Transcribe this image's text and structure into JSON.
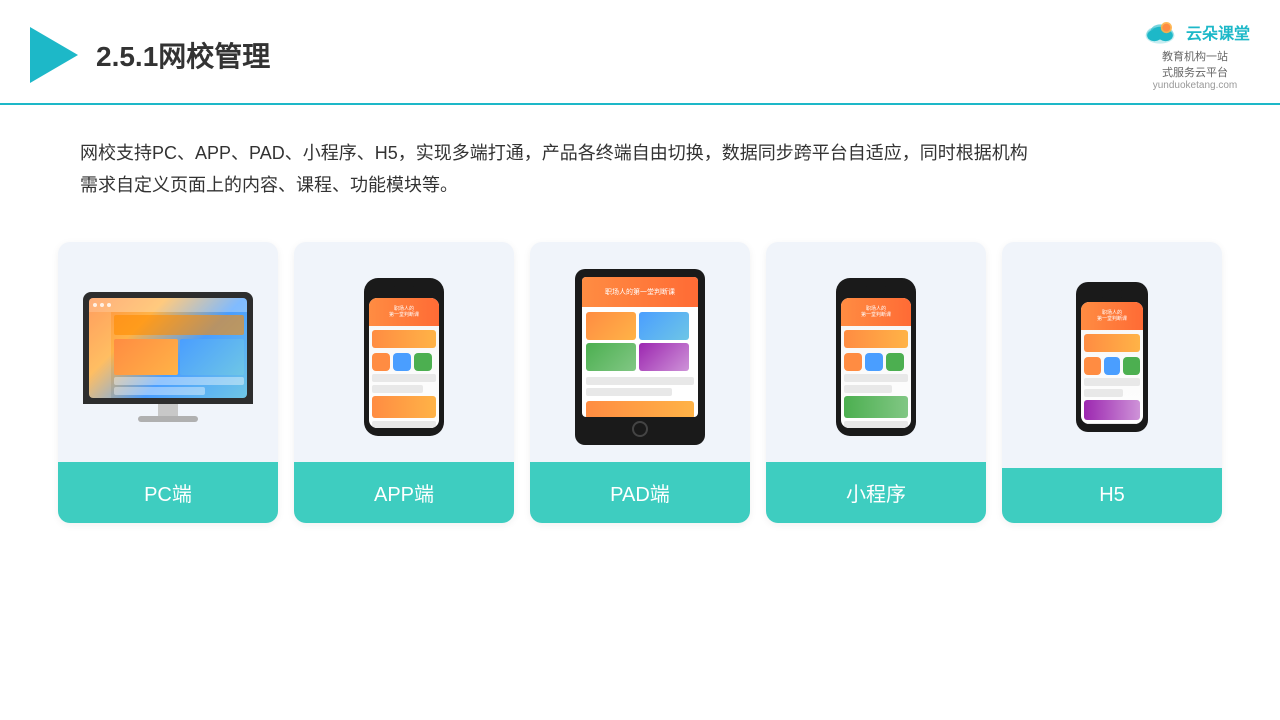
{
  "header": {
    "title": "2.5.1网校管理",
    "brand": {
      "name": "云朵课堂",
      "tagline": "教育机构一站\n式服务云平台",
      "url": "yunduoketang.com"
    }
  },
  "description": "网校支持PC、APP、PAD、小程序、H5，实现多端打通，产品各终端自由切换，数据同步跨平台自适应，同时根据机构\n需求自定义页面上的内容、课程、功能模块等。",
  "cards": [
    {
      "id": "pc",
      "label": "PC端",
      "type": "pc"
    },
    {
      "id": "app",
      "label": "APP端",
      "type": "phone"
    },
    {
      "id": "pad",
      "label": "PAD端",
      "type": "tablet"
    },
    {
      "id": "miniprogram",
      "label": "小程序",
      "type": "phone"
    },
    {
      "id": "h5",
      "label": "H5",
      "type": "phone-mini"
    }
  ],
  "accent_color": "#3ecdc0",
  "text_color": "#333333"
}
